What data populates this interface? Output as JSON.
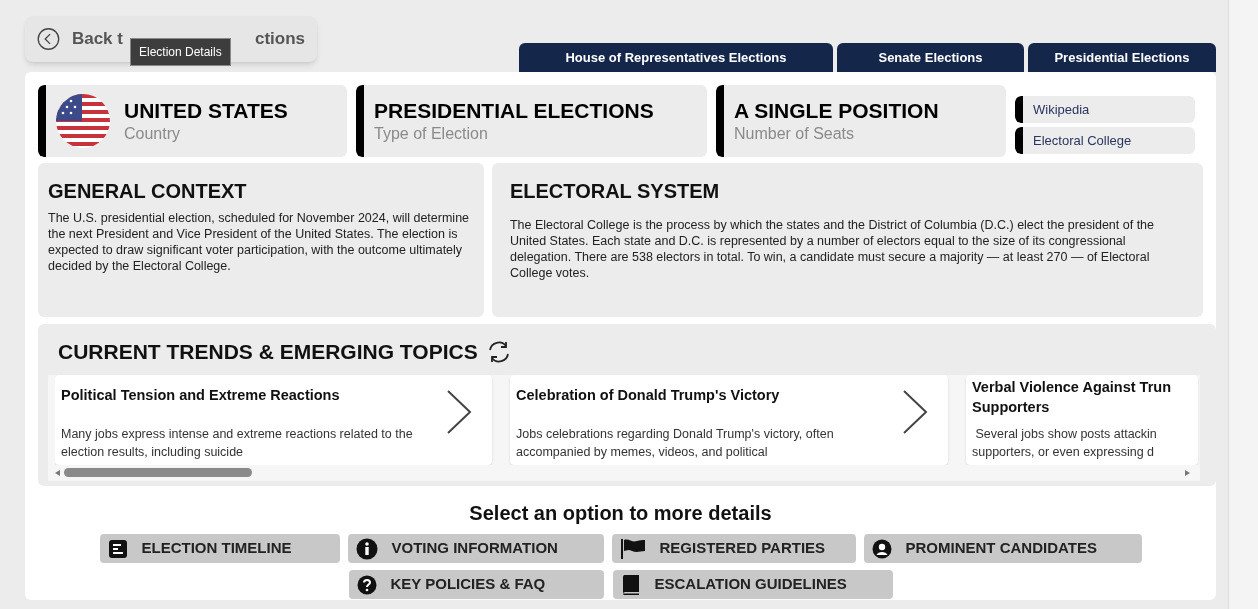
{
  "back_button": {
    "label_start": "Back t",
    "label_end": "ctions"
  },
  "tooltip": "Election Details",
  "tabs": [
    {
      "label": "House of Representatives Elections"
    },
    {
      "label": "Senate Elections"
    },
    {
      "label": "Presidential Elections"
    }
  ],
  "summary_cards": [
    {
      "kind": "flag",
      "value": "UNITED STATES",
      "caption": "Country"
    },
    {
      "kind": "plain",
      "value": "PRESIDENTIAL ELECTIONS",
      "caption": "Type of Election"
    },
    {
      "kind": "plain",
      "value": "A SINGLE POSITION",
      "caption": "Number of Seats"
    }
  ],
  "links": [
    "Wikipedia",
    "Electoral College"
  ],
  "general_context": {
    "title": "GENERAL CONTEXT",
    "text": "The U.S. presidential election, scheduled for November 2024, will determine the next President and Vice President of the United States. The election is expected to draw significant voter participation, with the outcome ultimately decided by the Electoral College."
  },
  "electoral_system": {
    "title": "ELECTORAL SYSTEM",
    "text": "The Electoral College is the process by which the states and the District of Columbia (D.C.) elect the president of the United States. Each state and D.C. is represented by a number of electors equal to the size of its congressional delegation. There are 538 electors in total. To win, a candidate must secure a majority — at least 270 — of Electoral College votes."
  },
  "trends": {
    "title": "CURRENT TRENDS & EMERGING TOPICS",
    "cards": [
      {
        "title": "Political Tension and Extreme Reactions",
        "text": "Many jobs express intense and extreme reactions related to the election results, including suicide"
      },
      {
        "title": "Celebration of Donald Trump's Victory",
        "text": "Jobs celebrations regarding Donald Trump's victory, often accompanied by memes, videos, and political"
      },
      {
        "title": "Verbal Violence Against Trun Supporters",
        "text": " Several jobs show posts attackin supporters, or even expressing d"
      }
    ]
  },
  "options": {
    "title": "Select an option to more details",
    "buttons": [
      {
        "kind": "timeline",
        "label": "ELECTION TIMELINE"
      },
      {
        "kind": "info",
        "label": "VOTING INFORMATION"
      },
      {
        "kind": "flag",
        "label": "REGISTERED PARTIES"
      },
      {
        "kind": "person",
        "label": "PROMINENT CANDIDATES"
      },
      {
        "kind": "question",
        "label": "KEY POLICIES & FAQ"
      },
      {
        "kind": "book",
        "label": "ESCALATION GUIDELINES"
      }
    ]
  }
}
